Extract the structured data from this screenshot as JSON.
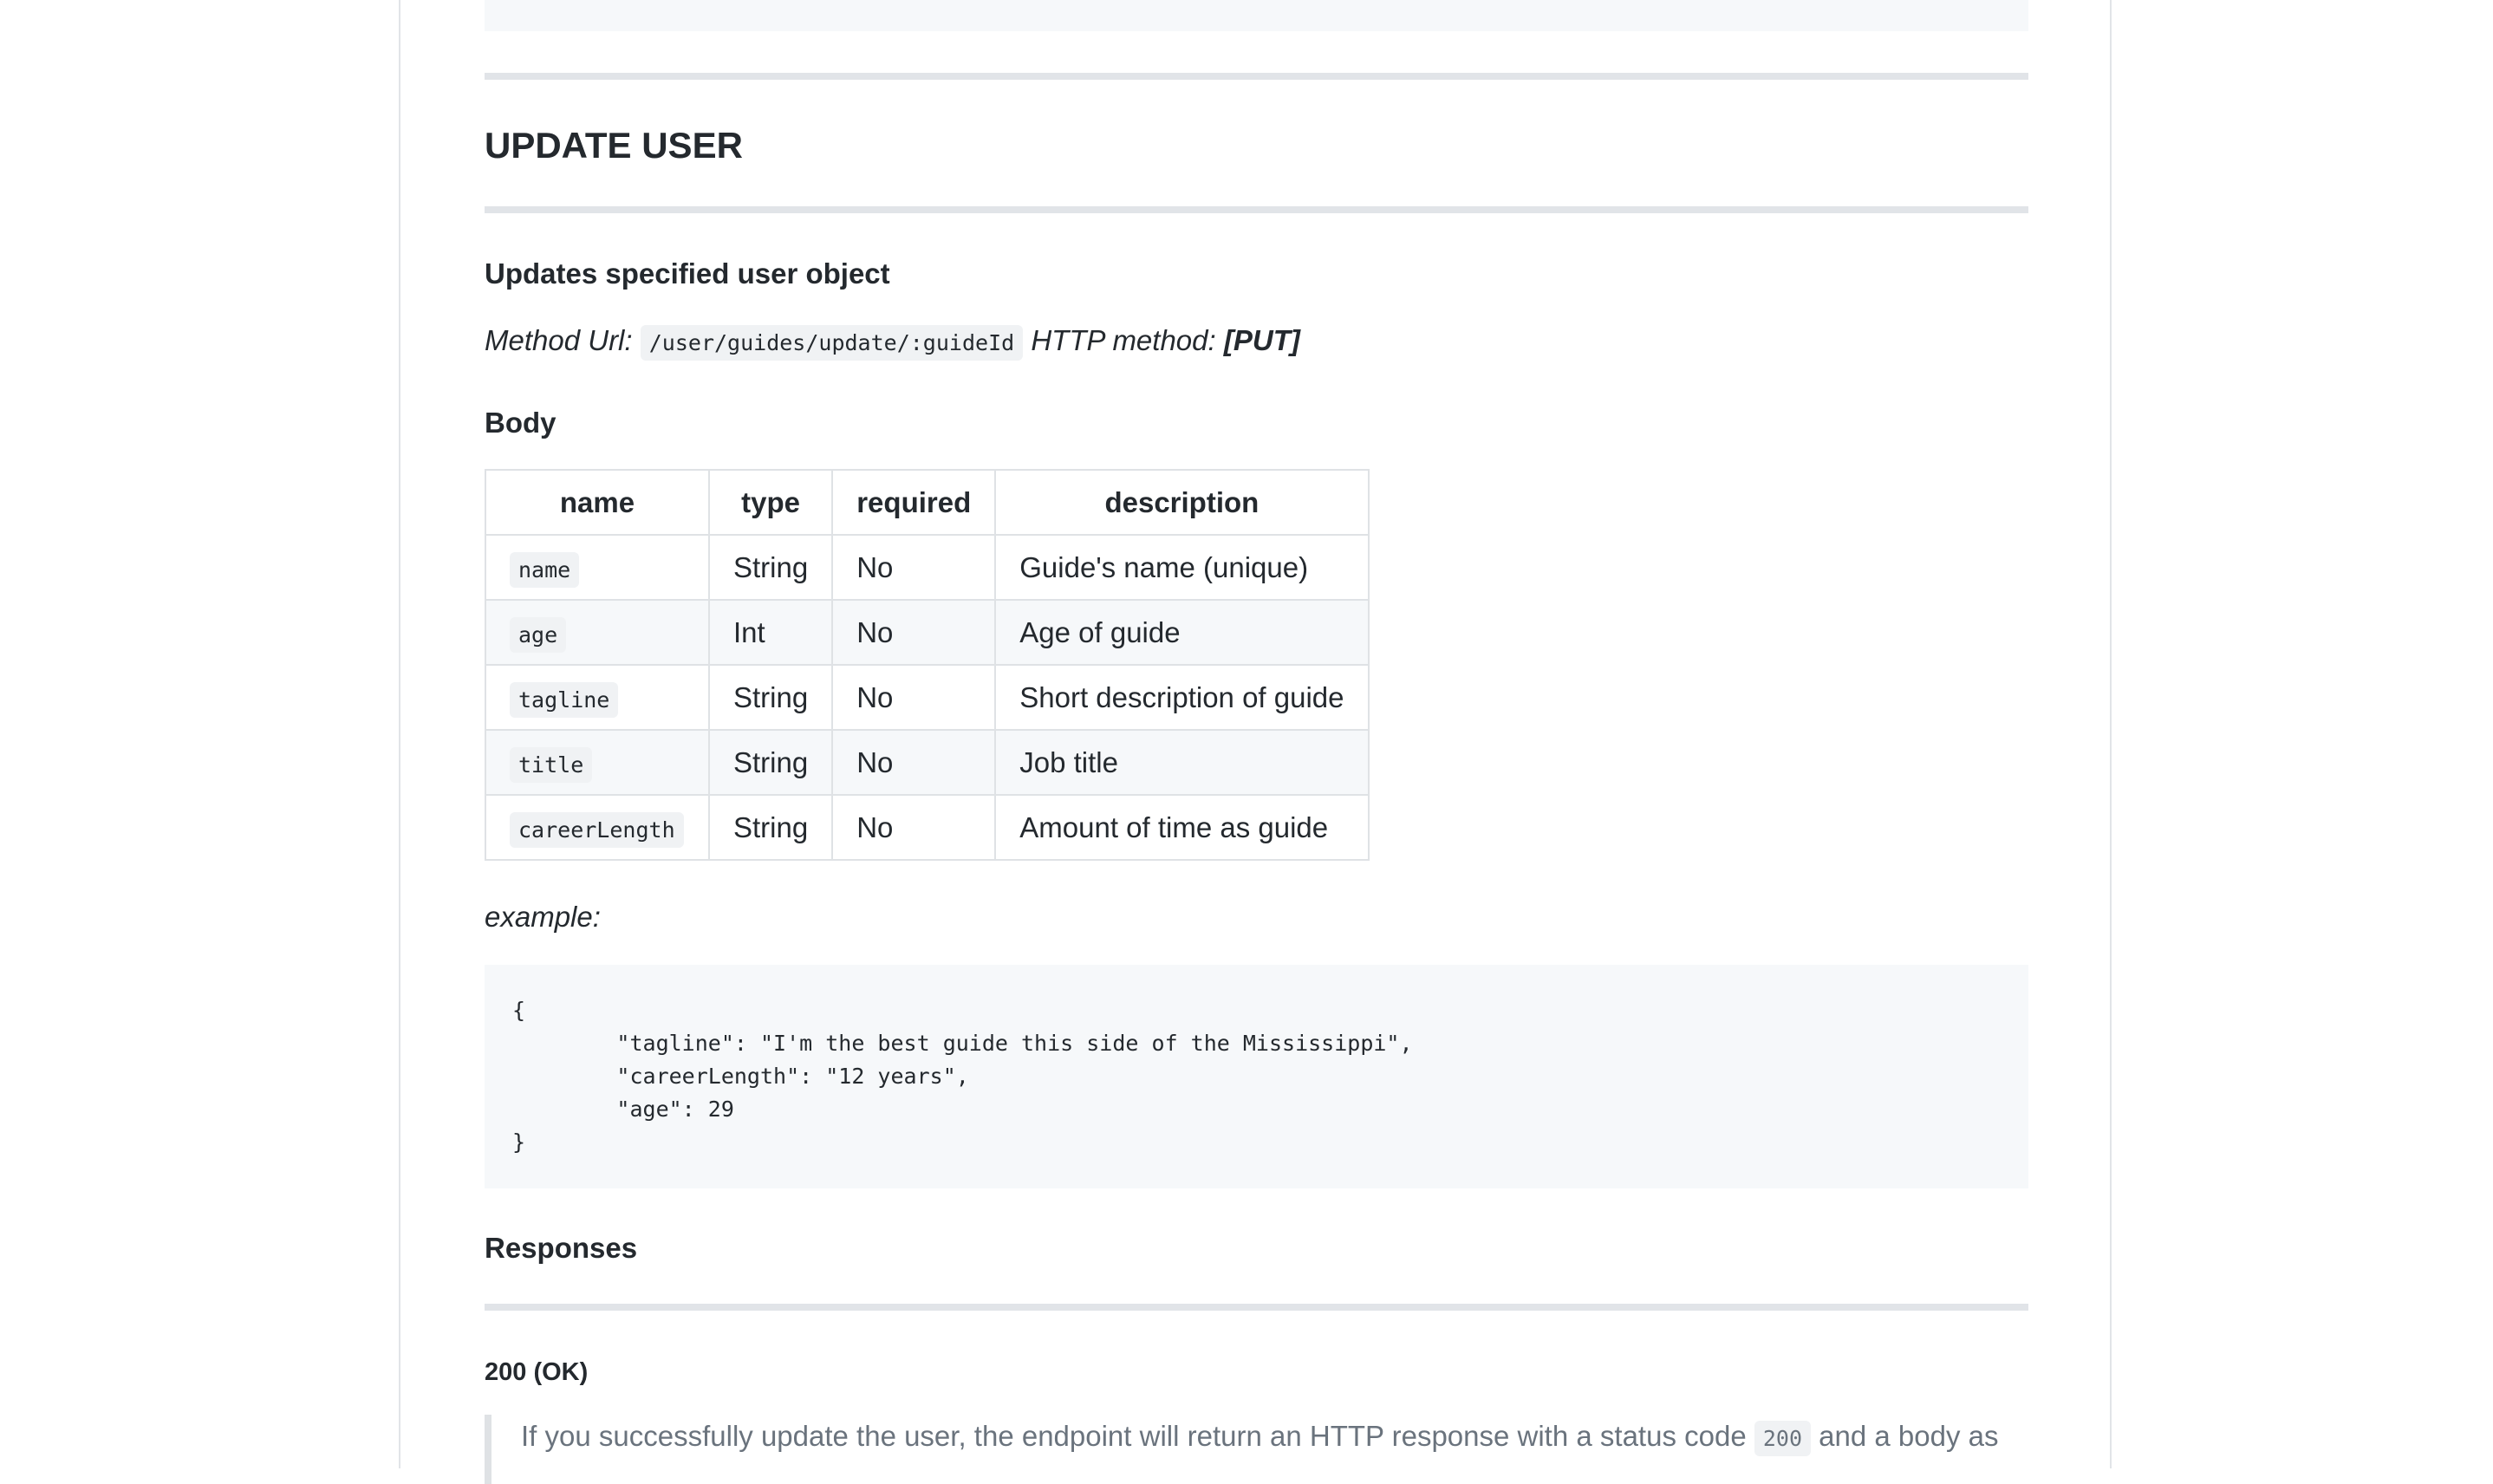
{
  "section": {
    "title": "UPDATE USER",
    "subtitle": "Updates specified user object",
    "method_url_label": "Method Url:",
    "method_url": "/user/guides/update/:guideId",
    "http_method_label": "HTTP method:",
    "http_method": "[PUT]",
    "body_heading": "Body"
  },
  "table": {
    "headers": [
      "name",
      "type",
      "required",
      "description"
    ],
    "rows": [
      {
        "name": "name",
        "type": "String",
        "required": "No",
        "description": "Guide's name (unique)"
      },
      {
        "name": "age",
        "type": "Int",
        "required": "No",
        "description": "Age of guide"
      },
      {
        "name": "tagline",
        "type": "String",
        "required": "No",
        "description": "Short description of guide"
      },
      {
        "name": "title",
        "type": "String",
        "required": "No",
        "description": "Job title"
      },
      {
        "name": "careerLength",
        "type": "String",
        "required": "No",
        "description": "Amount of time as guide"
      }
    ]
  },
  "example": {
    "label": "example:",
    "code": "{\n        \"tagline\": \"I'm the best guide this side of the Mississippi\",\n        \"careerLength\": \"12 years\",\n        \"age\": 29\n}"
  },
  "responses": {
    "heading": "Responses",
    "status": "200 (OK)",
    "text_before": "If you successfully update the user, the endpoint will return an HTTP response with a status code",
    "status_code": "200",
    "text_after": "and a body as"
  },
  "colors": {
    "rule": "#e1e4e8",
    "code_bg": "#f6f8fa",
    "text": "#24292e",
    "muted": "#6a737d"
  }
}
